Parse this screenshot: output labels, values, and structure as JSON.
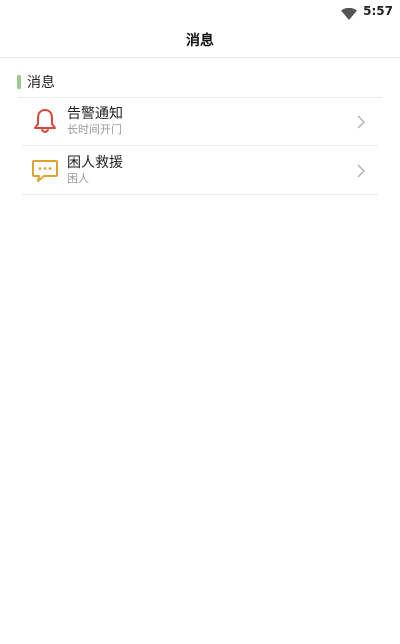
{
  "status_bar": {
    "time": "5:57",
    "wifi_icon": "wifi-icon"
  },
  "app_bar": {
    "title": "消息"
  },
  "section": {
    "label": "消息",
    "accent_color": "#9fc98a"
  },
  "items": [
    {
      "title": "告警通知",
      "subtitle": "长时间开门",
      "icon": "bell-icon",
      "icon_color": "#d9473a"
    },
    {
      "title": "困人救援",
      "subtitle": "困人",
      "icon": "chat-bubble-icon",
      "icon_color": "#e0a332"
    }
  ]
}
